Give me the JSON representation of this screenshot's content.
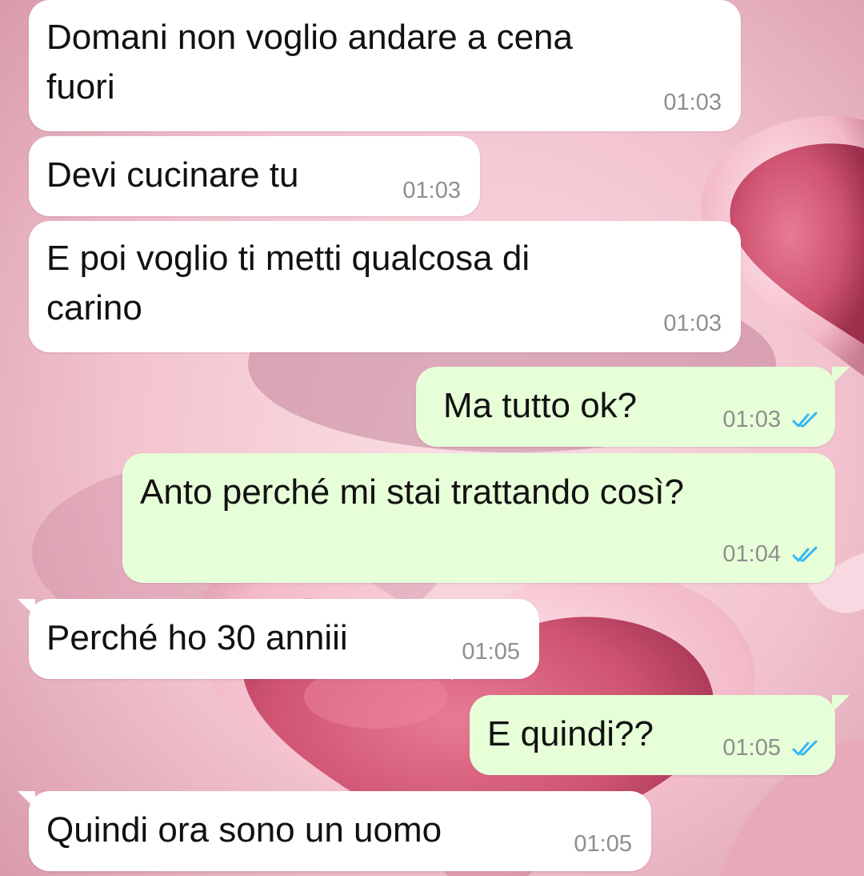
{
  "messages": [
    {
      "direction": "incoming",
      "text": "Domani non voglio andare a cena\nfuori",
      "time": "01:03"
    },
    {
      "direction": "incoming",
      "text": "Devi cucinare tu",
      "time": "01:03"
    },
    {
      "direction": "incoming",
      "text": "E poi voglio ti metti qualcosa di\ncarino",
      "time": "01:03"
    },
    {
      "direction": "outgoing",
      "text": "Ma tutto ok?",
      "time": "01:03",
      "status_icon": "double-check-read-icon"
    },
    {
      "direction": "outgoing",
      "text": "Anto perché mi stai trattando così?",
      "time": "01:04",
      "status_icon": "double-check-read-icon"
    },
    {
      "direction": "incoming",
      "text": "Perché ho 30 anniii",
      "time": "01:05"
    },
    {
      "direction": "outgoing",
      "text": "E quindi??",
      "time": "01:05",
      "status_icon": "double-check-read-icon"
    },
    {
      "direction": "incoming",
      "text": "Quindi ora sono un uomo",
      "time": "01:05"
    }
  ],
  "colors": {
    "incoming_bubble": "#ffffff",
    "outgoing_bubble": "#e7ffd8",
    "read_ticks": "#34b7f1",
    "timestamp": "#8e8e8e",
    "wallpaper_base": "#f3c9d3",
    "wallpaper_hearts": "#cf5472"
  },
  "wallpaper": {
    "theme": "pink-hearts"
  }
}
